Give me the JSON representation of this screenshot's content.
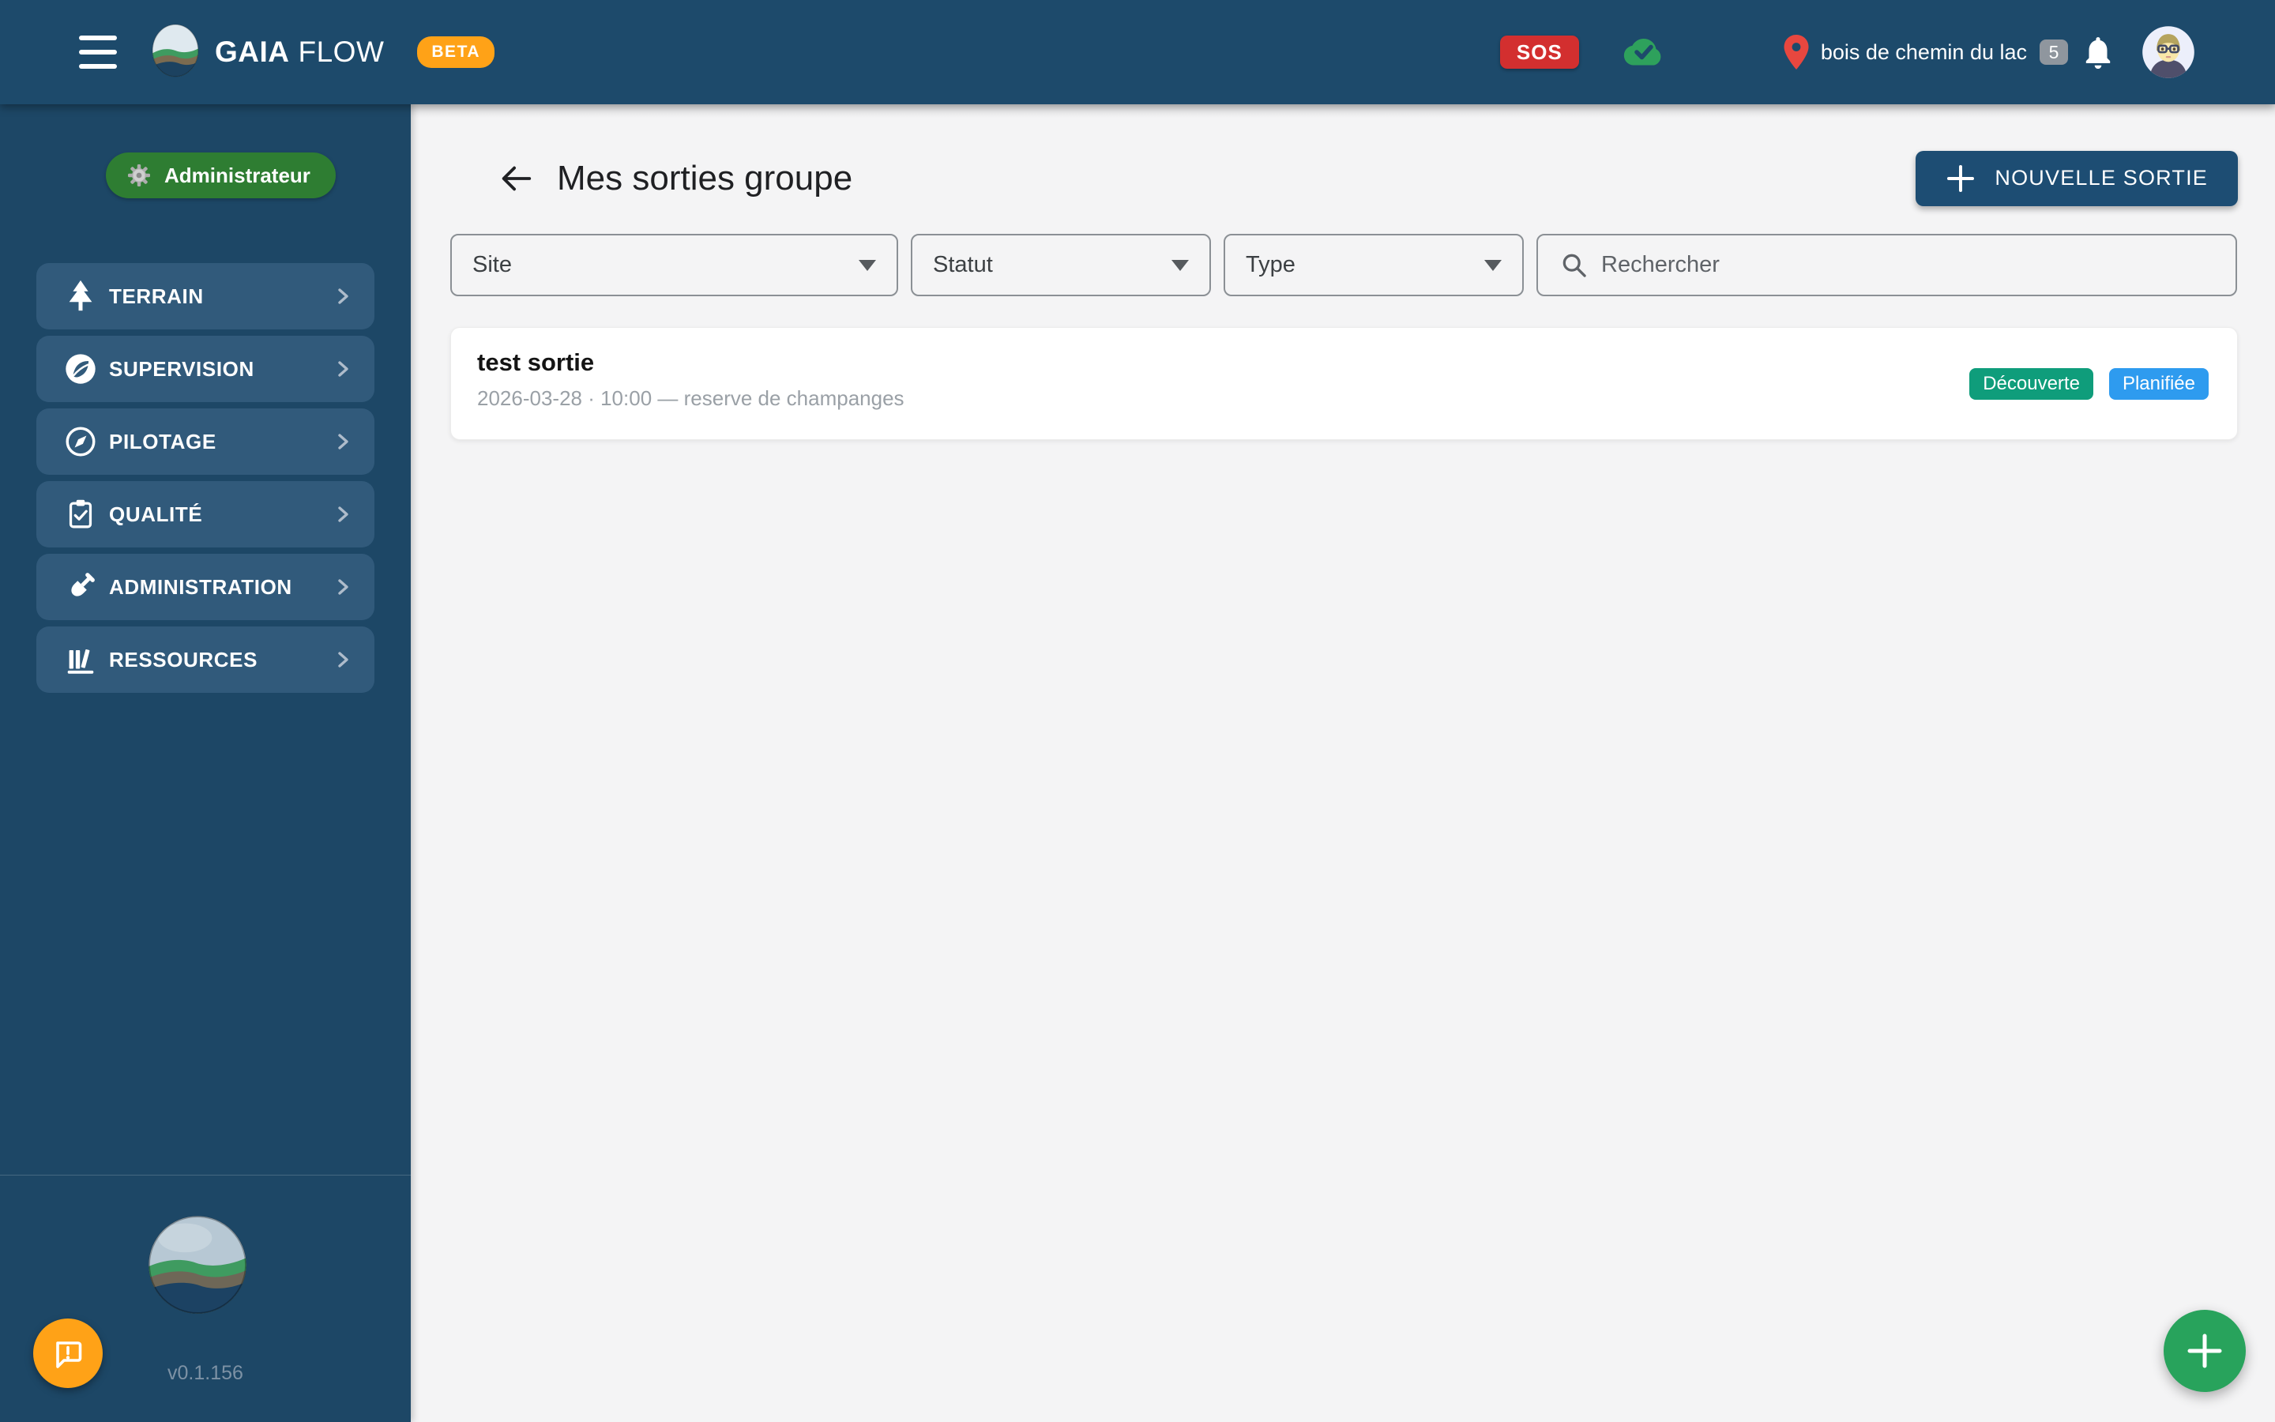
{
  "header": {
    "brand_bold": "GAIA",
    "brand_light": "FLOW",
    "beta_label": "BETA",
    "sos_label": "SOS",
    "site_name": "bois de chemin du lac",
    "site_badge_count": "5",
    "icons": [
      "hamburger-icon",
      "gaia-egg-logo",
      "cloud-check-icon",
      "location-pin-icon",
      "bell-icon",
      "user-avatar"
    ]
  },
  "sidebar": {
    "role_badge_label": "Administrateur",
    "role_badge_icon": "gear-icon",
    "items": [
      {
        "label": "TERRAIN",
        "icon": "pine-tree-icon"
      },
      {
        "label": "SUPERVISION",
        "icon": "leaf-circle-icon"
      },
      {
        "label": "PILOTAGE",
        "icon": "compass-icon"
      },
      {
        "label": "QUALITÉ",
        "icon": "clipboard-check-icon"
      },
      {
        "label": "ADMINISTRATION",
        "icon": "shovel-icon"
      },
      {
        "label": "RESSOURCES",
        "icon": "books-icon"
      }
    ],
    "version": "v0.1.156",
    "footer_icons": [
      "gaia-globe-logo",
      "feedback-chat-icon"
    ]
  },
  "main": {
    "title": "Mes sorties groupe",
    "back_icon": "arrow-left-icon",
    "new_button_label": "NOUVELLE SORTIE",
    "filters": [
      {
        "label": "Site"
      },
      {
        "label": "Statut"
      },
      {
        "label": "Type"
      }
    ],
    "search_placeholder": "Rechercher",
    "sorties": [
      {
        "title": "test sortie",
        "datetime": "2026-03-28 · 10:00 — reserve de champanges",
        "badges": [
          {
            "label": "Découverte",
            "color": "#0f9d7b"
          },
          {
            "label": "Planifiée",
            "color": "#2e9bef"
          }
        ]
      }
    ]
  },
  "colors": {
    "header_bg": "#1d4a6b",
    "sidebar_bg": "#1d4766",
    "nav_button_bg": "#315a7b",
    "primary_button_bg": "#1d4d73",
    "accent_amber": "#ffa217",
    "accent_green": "#2e7d32",
    "fab_green": "#28a35c",
    "sos_red": "#d32f2f",
    "pin_red": "#e8473f",
    "cloud_green": "#2ea15c",
    "badge_discovery": "#0f9d7b",
    "badge_planned": "#2e9bef"
  }
}
